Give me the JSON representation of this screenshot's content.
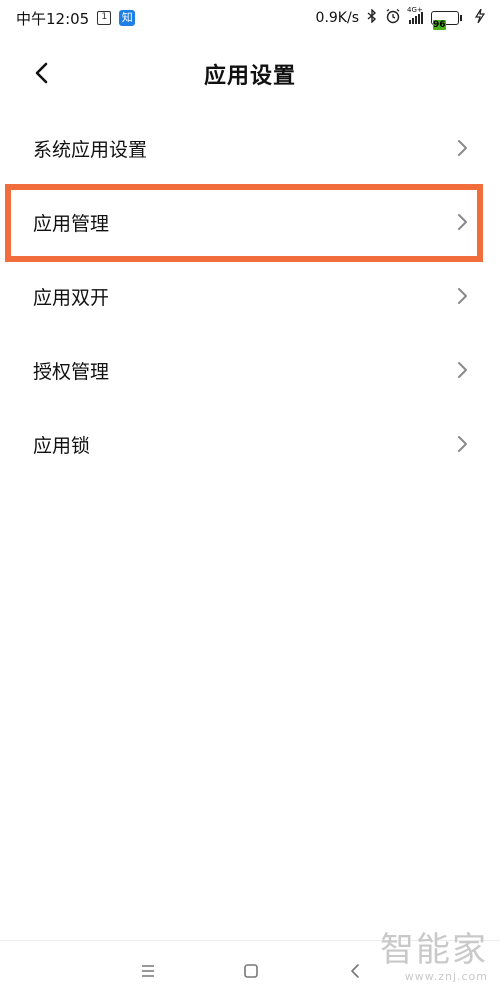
{
  "status_bar": {
    "time": "中午12:05",
    "calendar_badge": "1",
    "zhihu_badge": "知",
    "net_speed": "0.9K/s",
    "signal_type": "4G+",
    "battery_level": "96"
  },
  "header": {
    "title": "应用设置"
  },
  "list": {
    "items": [
      {
        "label": "系统应用设置"
      },
      {
        "label": "应用管理"
      },
      {
        "label": "应用双开"
      },
      {
        "label": "授权管理"
      },
      {
        "label": "应用锁"
      }
    ]
  },
  "highlight_color": "#f26d3c",
  "battery_color": "#4caf1e",
  "watermark": {
    "big": "智能家",
    "small": "www.znj.com"
  }
}
